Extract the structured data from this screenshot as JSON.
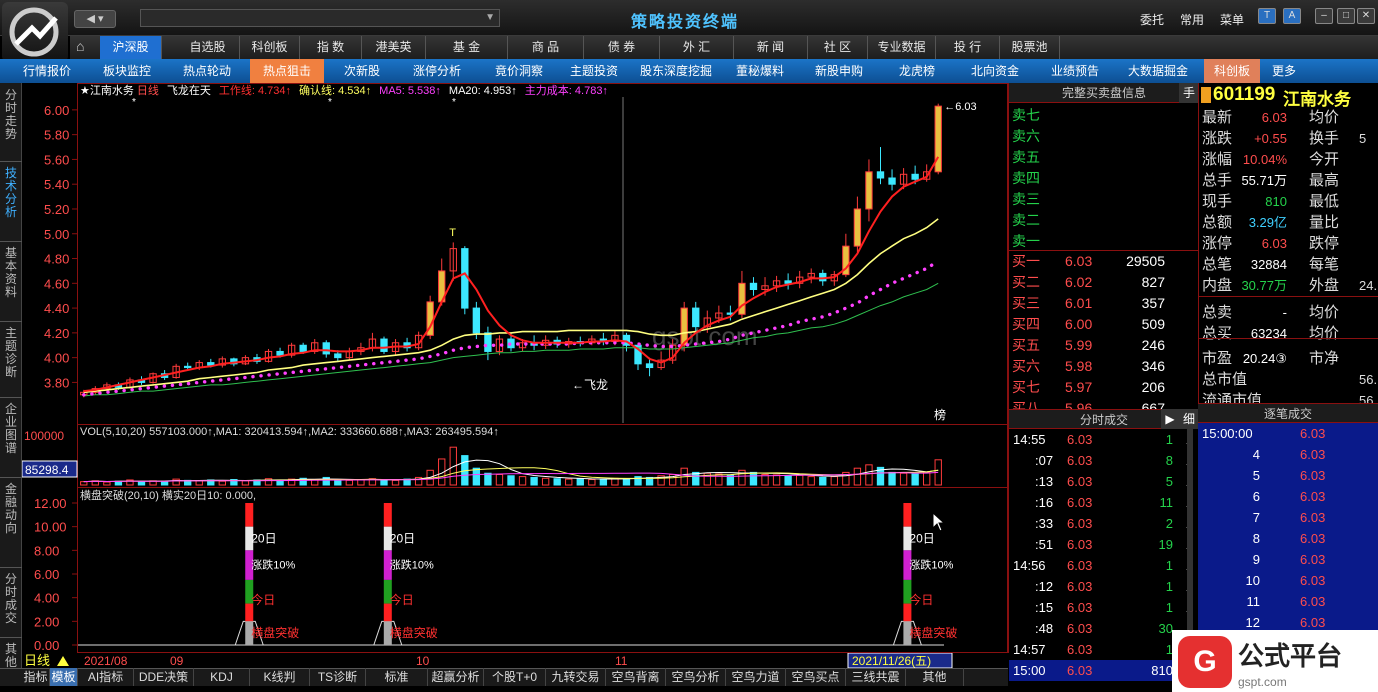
{
  "topbar": {
    "app_title": "策略投资终端",
    "menu_right": [
      "委托",
      "常用",
      "菜单"
    ]
  },
  "main_menu": [
    "沪深股",
    "自选股",
    "科创板",
    "指 数",
    "港美英",
    "基 金",
    "商 品",
    "债 券",
    "外 汇",
    "新 闻",
    "社 区",
    "专业数据",
    "投 行",
    "股票池"
  ],
  "sub_menu": [
    "行情报价",
    "板块监控",
    "热点轮动",
    "热点狙击",
    "次新股",
    "涨停分析",
    "竟价洞察",
    "主题投资",
    "股东深度挖掘",
    "董秘爆料",
    "新股申购",
    "龙虎榜",
    "北向资金",
    "业绩预告",
    "大数据掘金",
    "科创板",
    "更多"
  ],
  "left_tabs": [
    "分时走势",
    "技术分析",
    "基本资料",
    "主题诊断",
    "企业图谱",
    "金融动向",
    "分时成交",
    "其他"
  ],
  "chart": {
    "header": {
      "stock": "江南水务",
      "period": "日线",
      "indicator": "飞龙在天",
      "items": [
        {
          "label": "工作线: 4.734↑",
          "color": "#ff3030"
        },
        {
          "label": "确认线: 4.534↑",
          "color": "#ffff60"
        },
        {
          "label": "MA5: 5.538↑",
          "color": "#ff40ff"
        },
        {
          "label": "MA20: 4.953↑",
          "color": "#ffffff"
        },
        {
          "label": "主力成本: 4.783↑",
          "color": "#ff40ff"
        }
      ]
    },
    "annotations": {
      "top": "T",
      "flag": "←飞龙",
      "last": "←6.03",
      "bang": "榜"
    },
    "vol_header": "VOL(5,10,20) 557103.000↑,MA1: 320413.594↑,MA2: 333660.688↑,MA3: 263495.594↑",
    "vol_axis_top": "100000",
    "vol_current": "85298.4",
    "ind_header": "横盘突破(20,10) 横实20日10: 0.000,",
    "labels": {
      "days": "20日",
      "rise": "涨跌10%",
      "today": "今日",
      "break": "横盘突破"
    },
    "date_left": "日线",
    "dates": [
      "2021/08",
      "09",
      "10",
      "11"
    ],
    "date_cursor": "2021/11/26(五)",
    "watermark": "gspt.com"
  },
  "chart_data": {
    "type": "line",
    "title": "江南水务 日线",
    "ylim": [
      3.65,
      6.12
    ],
    "y_ticks": [
      "6.00",
      "5.80",
      "5.60",
      "5.40",
      "5.20",
      "5.00",
      "4.80",
      "4.60",
      "4.40",
      "4.20",
      "4.00",
      "3.80"
    ],
    "ind_ticks": [
      "12.00",
      "10.00",
      "8.00",
      "6.00",
      "4.00",
      "2.00",
      "0.00"
    ],
    "candles": [
      [
        3.7,
        3.72,
        3.74,
        3.68
      ],
      [
        3.72,
        3.75,
        3.77,
        3.7
      ],
      [
        3.75,
        3.78,
        3.8,
        3.73
      ],
      [
        3.78,
        3.76,
        3.8,
        3.74
      ],
      [
        3.76,
        3.82,
        3.84,
        3.75
      ],
      [
        3.82,
        3.8,
        3.85,
        3.78
      ],
      [
        3.8,
        3.87,
        3.88,
        3.79
      ],
      [
        3.87,
        3.84,
        3.9,
        3.82
      ],
      [
        3.84,
        3.93,
        3.95,
        3.83
      ],
      [
        3.93,
        3.92,
        3.96,
        3.9
      ],
      [
        3.92,
        3.96,
        3.98,
        3.9
      ],
      [
        3.96,
        3.94,
        3.99,
        3.92
      ],
      [
        3.94,
        3.99,
        4.01,
        3.92
      ],
      [
        3.99,
        3.95,
        4.0,
        3.93
      ],
      [
        3.95,
        4.0,
        4.02,
        3.94
      ],
      [
        4.0,
        3.97,
        4.03,
        3.95
      ],
      [
        3.97,
        4.05,
        4.07,
        3.96
      ],
      [
        4.05,
        4.02,
        4.08,
        4.0
      ],
      [
        4.02,
        4.1,
        4.12,
        4.0
      ],
      [
        4.1,
        4.05,
        4.12,
        4.03
      ],
      [
        4.05,
        4.12,
        4.15,
        4.03
      ],
      [
        4.12,
        4.03,
        4.14,
        4.0
      ],
      [
        4.03,
        4.0,
        4.06,
        3.97
      ],
      [
        4.0,
        4.05,
        4.08,
        3.98
      ],
      [
        4.05,
        4.08,
        4.12,
        4.02
      ],
      [
        4.08,
        4.15,
        4.2,
        4.05
      ],
      [
        4.15,
        4.05,
        4.17,
        4.03
      ],
      [
        4.05,
        4.12,
        4.15,
        4.02
      ],
      [
        4.12,
        4.08,
        4.16,
        4.05
      ],
      [
        4.08,
        4.18,
        4.21,
        4.06
      ],
      [
        4.18,
        4.45,
        4.5,
        4.15
      ],
      [
        4.45,
        4.7,
        4.8,
        4.42
      ],
      [
        4.7,
        4.88,
        4.93,
        4.62
      ],
      [
        4.88,
        4.4,
        4.9,
        4.35
      ],
      [
        4.4,
        4.2,
        4.45,
        4.15
      ],
      [
        4.2,
        4.05,
        4.25,
        3.98
      ],
      [
        4.05,
        4.15,
        4.18,
        4.02
      ],
      [
        4.15,
        4.08,
        4.2,
        4.05
      ],
      [
        4.08,
        4.12,
        4.15,
        4.05
      ],
      [
        4.12,
        4.1,
        4.18,
        4.06
      ],
      [
        4.1,
        4.14,
        4.18,
        4.07
      ],
      [
        4.14,
        4.11,
        4.17,
        4.08
      ],
      [
        4.11,
        4.13,
        4.16,
        4.08
      ],
      [
        4.13,
        4.12,
        4.17,
        4.09
      ],
      [
        4.12,
        4.15,
        4.18,
        4.1
      ],
      [
        4.15,
        4.13,
        4.2,
        4.1
      ],
      [
        4.13,
        4.18,
        4.22,
        4.1
      ],
      [
        4.18,
        4.1,
        4.2,
        4.05
      ],
      [
        4.1,
        3.95,
        4.12,
        3.9
      ],
      [
        3.95,
        3.92,
        4.0,
        3.85
      ],
      [
        3.92,
        3.98,
        4.05,
        3.9
      ],
      [
        3.98,
        4.1,
        4.15,
        3.95
      ],
      [
        4.1,
        4.4,
        4.45,
        4.05
      ],
      [
        4.4,
        4.25,
        4.45,
        4.2
      ],
      [
        4.25,
        4.32,
        4.38,
        4.2
      ],
      [
        4.32,
        4.36,
        4.42,
        4.28
      ],
      [
        4.36,
        4.35,
        4.42,
        4.3
      ],
      [
        4.35,
        4.6,
        4.7,
        4.32
      ],
      [
        4.6,
        4.55,
        4.65,
        4.5
      ],
      [
        4.55,
        4.58,
        4.65,
        4.5
      ],
      [
        4.58,
        4.62,
        4.66,
        4.53
      ],
      [
        4.62,
        4.6,
        4.68,
        4.55
      ],
      [
        4.6,
        4.65,
        4.7,
        4.56
      ],
      [
        4.65,
        4.68,
        4.72,
        4.6
      ],
      [
        4.68,
        4.62,
        4.71,
        4.58
      ],
      [
        4.62,
        4.67,
        4.7,
        4.58
      ],
      [
        4.67,
        4.9,
        5.0,
        4.65
      ],
      [
        4.9,
        5.2,
        5.3,
        4.85
      ],
      [
        5.2,
        5.5,
        5.6,
        5.1
      ],
      [
        5.5,
        5.45,
        5.7,
        5.4
      ],
      [
        5.45,
        5.4,
        5.52,
        5.35
      ],
      [
        5.4,
        5.48,
        5.53,
        5.36
      ],
      [
        5.48,
        5.44,
        5.55,
        5.4
      ],
      [
        5.44,
        5.5,
        5.56,
        5.42
      ],
      [
        5.5,
        6.03,
        6.05,
        5.48
      ]
    ],
    "work_line": [
      3.73,
      3.74,
      3.76,
      3.78,
      3.8,
      3.82,
      3.84,
      3.86,
      3.88,
      3.9,
      3.92,
      3.93,
      3.95,
      3.96,
      3.97,
      3.98,
      4.0,
      4.01,
      4.03,
      4.04,
      4.06,
      4.06,
      4.05,
      4.05,
      4.06,
      4.08,
      4.08,
      4.09,
      4.09,
      4.11,
      4.25,
      4.45,
      4.64,
      4.68,
      4.55,
      4.38,
      4.26,
      4.18,
      4.14,
      4.12,
      4.12,
      4.12,
      4.12,
      4.12,
      4.13,
      4.13,
      4.14,
      4.13,
      4.07,
      3.99,
      3.96,
      4.0,
      4.12,
      4.2,
      4.26,
      4.3,
      4.33,
      4.42,
      4.48,
      4.53,
      4.57,
      4.59,
      4.61,
      4.64,
      4.64,
      4.65,
      4.72,
      4.84,
      5.02,
      5.18,
      5.3,
      5.38,
      5.42,
      5.46,
      5.62
    ],
    "confirm_line": [
      3.72,
      3.73,
      3.74,
      3.75,
      3.76,
      3.77,
      3.78,
      3.79,
      3.8,
      3.81,
      3.83,
      3.84,
      3.85,
      3.86,
      3.87,
      3.88,
      3.9,
      3.91,
      3.92,
      3.94,
      3.95,
      3.96,
      3.97,
      3.98,
      3.99,
      4.0,
      4.01,
      4.02,
      4.03,
      4.04,
      4.06,
      4.1,
      4.15,
      4.18,
      4.19,
      4.19,
      4.2,
      4.2,
      4.21,
      4.21,
      4.21,
      4.21,
      4.22,
      4.22,
      4.22,
      4.22,
      4.22,
      4.22,
      4.21,
      4.19,
      4.18,
      4.18,
      4.2,
      4.21,
      4.23,
      4.25,
      4.27,
      4.31,
      4.34,
      4.37,
      4.4,
      4.43,
      4.46,
      4.49,
      4.52,
      4.55,
      4.6,
      4.67,
      4.76,
      4.84,
      4.9,
      4.96,
      5.0,
      5.05,
      5.12
    ],
    "cost_line": [
      3.7,
      3.71,
      3.72,
      3.73,
      3.74,
      3.75,
      3.76,
      3.77,
      3.78,
      3.79,
      3.8,
      3.81,
      3.82,
      3.83,
      3.84,
      3.85,
      3.86,
      3.87,
      3.88,
      3.89,
      3.9,
      3.91,
      3.92,
      3.93,
      3.94,
      3.95,
      3.96,
      3.97,
      3.98,
      3.99,
      4.01,
      4.03,
      4.06,
      4.08,
      4.09,
      4.1,
      4.1,
      4.11,
      4.11,
      4.11,
      4.11,
      4.11,
      4.11,
      4.12,
      4.12,
      4.12,
      4.12,
      4.12,
      4.11,
      4.1,
      4.09,
      4.09,
      4.1,
      4.11,
      4.12,
      4.13,
      4.15,
      4.18,
      4.2,
      4.22,
      4.24,
      4.26,
      4.29,
      4.31,
      4.33,
      4.36,
      4.4,
      4.44,
      4.5,
      4.55,
      4.6,
      4.64,
      4.68,
      4.72,
      4.78
    ],
    "ma_long": [
      3.69,
      3.7,
      3.7,
      3.71,
      3.72,
      3.73,
      3.73,
      3.74,
      3.75,
      3.76,
      3.77,
      3.78,
      3.78,
      3.79,
      3.8,
      3.81,
      3.82,
      3.83,
      3.84,
      3.85,
      3.86,
      3.87,
      3.88,
      3.89,
      3.9,
      3.91,
      3.92,
      3.93,
      3.94,
      3.95,
      3.96,
      3.98,
      4.0,
      4.01,
      4.02,
      4.03,
      4.04,
      4.04,
      4.05,
      4.05,
      4.06,
      4.06,
      4.06,
      4.07,
      4.07,
      4.07,
      4.08,
      4.08,
      4.08,
      4.07,
      4.07,
      4.07,
      4.08,
      4.09,
      4.1,
      4.11,
      4.12,
      4.14,
      4.16,
      4.17,
      4.19,
      4.2,
      4.22,
      4.24,
      4.25,
      4.27,
      4.3,
      4.34,
      4.38,
      4.42,
      4.45,
      4.49,
      4.52,
      4.55,
      4.6
    ],
    "volume": [
      8,
      10,
      7,
      9,
      12,
      8,
      10,
      9,
      14,
      11,
      10,
      12,
      9,
      13,
      10,
      12,
      15,
      11,
      14,
      16,
      12,
      18,
      10,
      11,
      13,
      15,
      12,
      11,
      14,
      18,
      35,
      62,
      90,
      70,
      40,
      28,
      25,
      22,
      20,
      18,
      16,
      15,
      14,
      15,
      13,
      14,
      16,
      15,
      20,
      18,
      22,
      25,
      40,
      30,
      28,
      26,
      24,
      35,
      30,
      25,
      24,
      22,
      23,
      20,
      18,
      20,
      30,
      40,
      48,
      42,
      30,
      28,
      26,
      30,
      60
    ],
    "ind_spikes": [
      [
        14,
        12.0
      ],
      [
        30,
        12.0
      ],
      [
        90,
        12.0
      ]
    ]
  },
  "orderbook": {
    "title": "完整买卖盘信息",
    "hand": "手",
    "sells": [
      "卖七",
      "卖六",
      "卖五",
      "卖四",
      "卖三",
      "卖二",
      "卖一"
    ],
    "buys": [
      {
        "label": "买一",
        "price": "6.03",
        "vol": "29505"
      },
      {
        "label": "买二",
        "price": "6.02",
        "vol": "827"
      },
      {
        "label": "买三",
        "price": "6.01",
        "vol": "357"
      },
      {
        "label": "买四",
        "price": "6.00",
        "vol": "509"
      },
      {
        "label": "买五",
        "price": "5.99",
        "vol": "246"
      },
      {
        "label": "买六",
        "price": "5.98",
        "vol": "346"
      },
      {
        "label": "买七",
        "price": "5.97",
        "vol": "206"
      },
      {
        "label": "买八",
        "price": "5.96",
        "vol": "667"
      }
    ]
  },
  "time_sales": {
    "title": "分时成交",
    "detail": "细",
    "rows": [
      {
        "t": "14:55",
        "p": "6.03",
        "v": "1",
        "x": "1",
        "c": "#24d24b"
      },
      {
        "t": ":07",
        "p": "6.03",
        "v": "8",
        "x": "1",
        "c": "#24d24b"
      },
      {
        "t": ":13",
        "p": "6.03",
        "v": "5",
        "x": "1",
        "c": "#24d24b"
      },
      {
        "t": ":16",
        "p": "6.03",
        "v": "11",
        "x": "1",
        "c": "#24d24b"
      },
      {
        "t": ":33",
        "p": "6.03",
        "v": "2",
        "x": "1",
        "c": "#24d24b"
      },
      {
        "t": ":51",
        "p": "6.03",
        "v": "19",
        "x": "1",
        "c": "#24d24b"
      },
      {
        "t": "14:56",
        "p": "6.03",
        "v": "1",
        "x": "1",
        "c": "#24d24b"
      },
      {
        "t": ":12",
        "p": "6.03",
        "v": "1",
        "x": "1",
        "c": "#24d24b"
      },
      {
        "t": ":15",
        "p": "6.03",
        "v": "1",
        "x": "1",
        "c": "#24d24b"
      },
      {
        "t": ":48",
        "p": "6.03",
        "v": "30",
        "x": "1",
        "c": "#24d24b"
      },
      {
        "t": "14:57",
        "p": "6.03",
        "v": "1",
        "x": "1",
        "c": "#24d24b"
      },
      {
        "t": "15:00",
        "p": "6.03",
        "v": "810",
        "x": "1",
        "c": "#ffffff"
      }
    ]
  },
  "quote": {
    "code": "601199",
    "name": "江南水务",
    "rows": [
      {
        "l1": "最新",
        "v1": "6.03",
        "c1": "#ff4d4d",
        "l2": "均价",
        "v2": ""
      },
      {
        "l1": "涨跌",
        "v1": "+0.55",
        "c1": "#ff4d4d",
        "l2": "换手",
        "v2": "5"
      },
      {
        "l1": "涨幅",
        "v1": "10.04%",
        "c1": "#ff4d4d",
        "l2": "今开",
        "v2": ""
      },
      {
        "l1": "总手",
        "v1": "55.71万",
        "c1": "#ffffff",
        "l2": "最高",
        "v2": ""
      },
      {
        "l1": "现手",
        "v1": "810",
        "c1": "#24d24b",
        "l2": "最低",
        "v2": ""
      },
      {
        "l1": "总额",
        "v1": "3.29亿",
        "c1": "#3fd0ff",
        "l2": "量比",
        "v2": ""
      },
      {
        "l1": "涨停",
        "v1": "6.03",
        "c1": "#ff4d4d",
        "l2": "跌停",
        "v2": ""
      },
      {
        "l1": "总笔",
        "v1": "32884",
        "c1": "#ffffff",
        "l2": "每笔",
        "v2": ""
      },
      {
        "l1": "内盘",
        "v1": "30.77万",
        "c1": "#24d24b",
        "l2": "外盘",
        "v2": "24."
      },
      {
        "l1": "总卖",
        "v1": "-",
        "c1": "#ffffff",
        "l2": "均价",
        "v2": ""
      },
      {
        "l1": "总买",
        "v1": "63234",
        "c1": "#ffffff",
        "l2": "均价",
        "v2": ""
      },
      {
        "l1": "市盈",
        "v1": "20.24③",
        "c1": "#ffffff",
        "l2": "市净",
        "v2": ""
      },
      {
        "l1": "总市值",
        "v1": "",
        "c1": "#ffffff",
        "l2": "",
        "v2": "56."
      },
      {
        "l1": "流通市值",
        "v1": "",
        "c1": "#ffffff",
        "l2": "",
        "v2": "56."
      }
    ]
  },
  "tick_sales": {
    "title": "逐笔成交",
    "rows": [
      {
        "a": "15:00:00",
        "b": "6.03"
      },
      {
        "a": "4",
        "b": "6.03"
      },
      {
        "a": "5",
        "b": "6.03"
      },
      {
        "a": "6",
        "b": "6.03"
      },
      {
        "a": "7",
        "b": "6.03"
      },
      {
        "a": "8",
        "b": "6.03"
      },
      {
        "a": "9",
        "b": "6.03"
      },
      {
        "a": "10",
        "b": "6.03"
      },
      {
        "a": "11",
        "b": "6.03"
      },
      {
        "a": "12",
        "b": "6.03"
      }
    ]
  },
  "bottom_tabs": [
    "指标",
    "模板",
    "AI指标",
    "DDE决策",
    "KDJ",
    "K线判",
    "TS诊断",
    "标准",
    "超赢分析",
    "个股T+0",
    "九转交易",
    "空鸟背离",
    "空鸟分析",
    "空鸟力道",
    "空鸟买点",
    "三线共震",
    "其他"
  ],
  "gs_logo": {
    "text": "公式平台",
    "sub": "gspt.com"
  }
}
